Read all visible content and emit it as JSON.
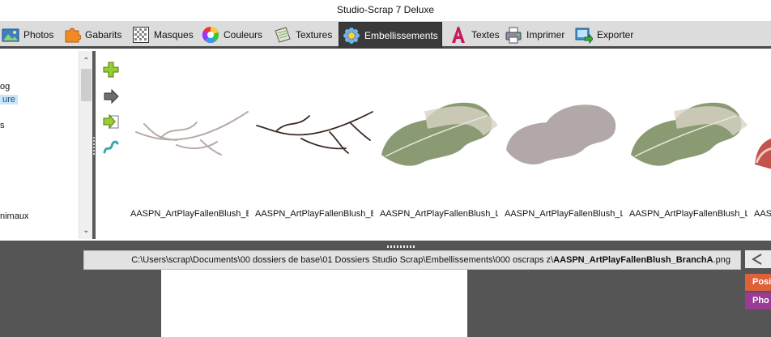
{
  "window": {
    "title": "Studio-Scrap 7 Deluxe"
  },
  "tabs": [
    {
      "label": "Photos",
      "icon": "photos-icon"
    },
    {
      "label": "Gabarits",
      "icon": "puzzle-icon"
    },
    {
      "label": "Masques",
      "icon": "mask-icon"
    },
    {
      "label": "Couleurs",
      "icon": "color-wheel-icon"
    },
    {
      "label": "Textures",
      "icon": "texture-icon"
    },
    {
      "label": "Embellissements",
      "icon": "gear-flower-icon",
      "active": true
    },
    {
      "label": "Textes",
      "icon": "text-a-icon"
    },
    {
      "label": "Imprimer",
      "icon": "printer-icon"
    },
    {
      "label": "Exporter",
      "icon": "export-icon"
    }
  ],
  "folders": [
    {
      "label": "og"
    },
    {
      "label": "ure",
      "selected": true
    },
    {
      "label": "s"
    },
    {
      "label": "nimaux"
    }
  ],
  "gallery": {
    "items": [
      {
        "caption": "AASPN_ArtPlayFallenBlush_Bra",
        "kind": "branch-light"
      },
      {
        "caption": "AASPN_ArtPlayFallenBlush_Bra",
        "kind": "branch-dark"
      },
      {
        "caption": "AASPN_ArtPlayFallenBlush_Le",
        "kind": "leaf-green"
      },
      {
        "caption": "AASPN_ArtPlayFallenBlush_Le",
        "kind": "leaf-shadow"
      },
      {
        "caption": "AASPN_ArtPlayFallenBlush_Le",
        "kind": "leaf-green"
      },
      {
        "caption": "AASPI",
        "kind": "leaf-red"
      }
    ]
  },
  "status": {
    "path_prefix": "C:\\Users\\scrap\\Documents\\00 dossiers de base\\01 Dossiers Studio Scrap\\Embellissements\\000 oscraps z\\",
    "file_name": "AASPN_ArtPlayFallenBlush_BranchA",
    "file_ext": ".png"
  },
  "right_panel": {
    "buttons": [
      {
        "label": "Posi",
        "color": "#e0603a"
      },
      {
        "label": "Pho",
        "color": "#9b3b93"
      }
    ]
  },
  "colors": {
    "tab_active_bg": "#3a3a3a",
    "workspace_bg": "#555555",
    "selection": "#cde6f7"
  }
}
